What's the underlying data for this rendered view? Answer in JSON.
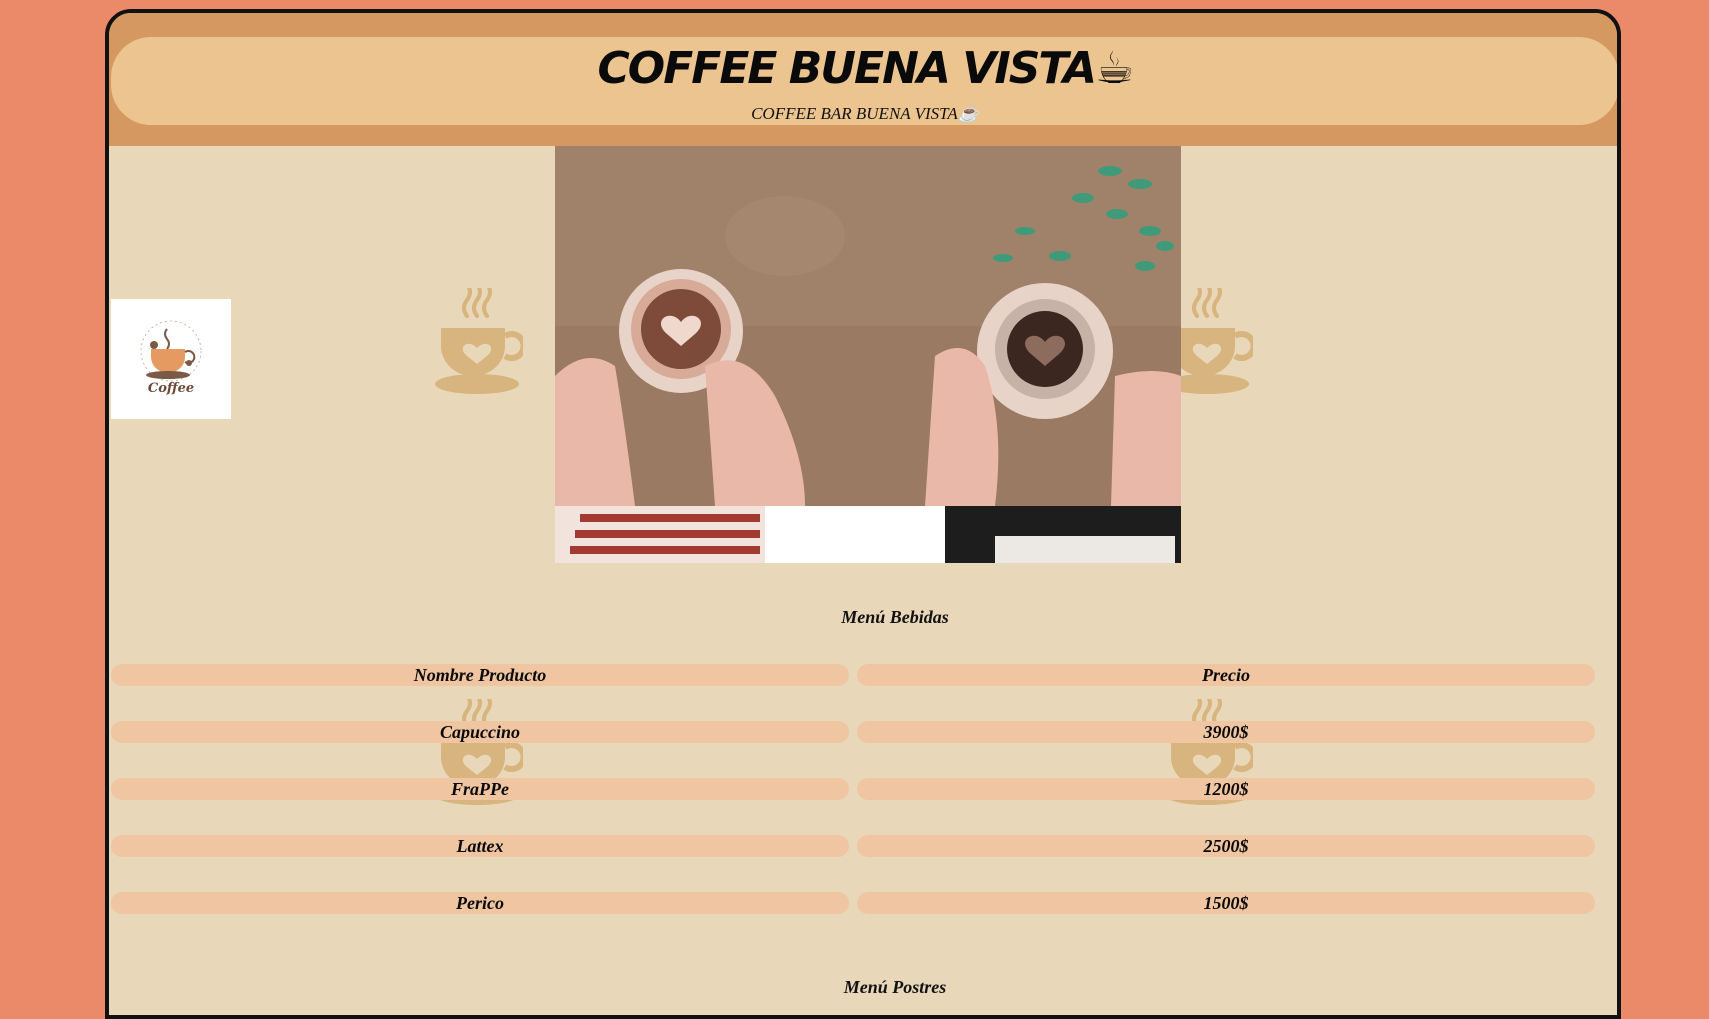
{
  "header": {
    "title": "COFFEE BUENA VISTA☕",
    "subtitle": "COFFEE BAR BUENA VISTA☕"
  },
  "logo": {
    "text": "Coffee"
  },
  "hero": {
    "icon": "coffee-couple-illustration"
  },
  "drinks_menu": {
    "title": "Menú Bebidas",
    "columns": [
      "Nombre Producto",
      "Precio"
    ],
    "rows": [
      {
        "name": "Capuccino",
        "price": "3900$"
      },
      {
        "name": "FraPPe",
        "price": "1200$"
      },
      {
        "name": "Lattex",
        "price": "2500$"
      },
      {
        "name": "Perico",
        "price": "1500$"
      }
    ]
  },
  "desserts_menu": {
    "title": "Menú Postres"
  },
  "colors": {
    "background": "#eb8a68",
    "page": "#e8d7b8",
    "header_band": "#d59860",
    "header_inner": "#ebc48f",
    "cell": "#f0c6a2",
    "deco": "#d8b47e"
  }
}
